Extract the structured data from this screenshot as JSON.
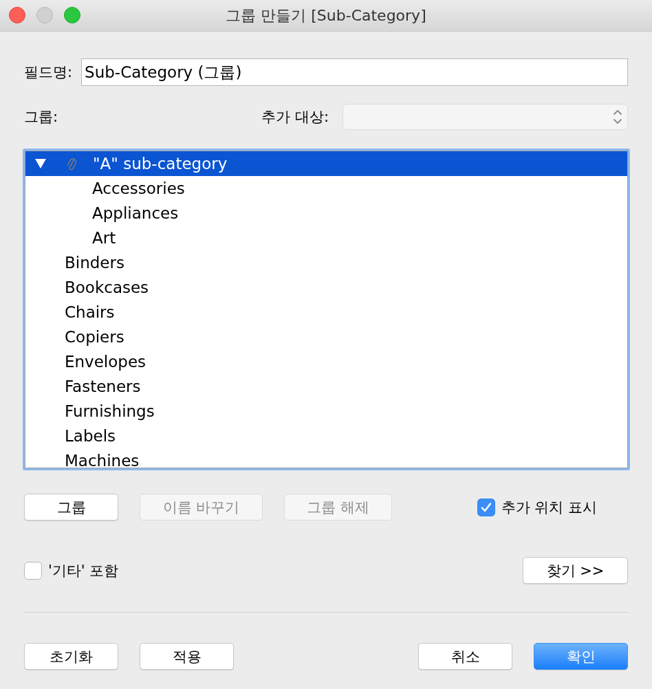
{
  "window": {
    "title": "그룹 만들기 [Sub-Category]"
  },
  "field_name": {
    "label": "필드명:",
    "value": "Sub-Category (그룹)"
  },
  "group_label": "그룹:",
  "add_to": {
    "label": "추가 대상:",
    "disabled": true
  },
  "tree": {
    "items": [
      {
        "kind": "group",
        "label": "\"A\" sub-category",
        "expanded": true,
        "selected": true,
        "children": [
          {
            "kind": "member",
            "label": "Accessories",
            "selected": false
          },
          {
            "kind": "member",
            "label": "Appliances",
            "selected": false
          },
          {
            "kind": "member",
            "label": "Art",
            "selected": false
          }
        ]
      },
      {
        "kind": "member",
        "label": "Binders",
        "selected": false
      },
      {
        "kind": "member",
        "label": "Bookcases",
        "selected": false
      },
      {
        "kind": "member",
        "label": "Chairs",
        "selected": false
      },
      {
        "kind": "member",
        "label": "Copiers",
        "selected": false
      },
      {
        "kind": "member",
        "label": "Envelopes",
        "selected": false
      },
      {
        "kind": "member",
        "label": "Fasteners",
        "selected": false
      },
      {
        "kind": "member",
        "label": "Furnishings",
        "selected": false
      },
      {
        "kind": "member",
        "label": "Labels",
        "selected": false
      },
      {
        "kind": "member",
        "label": "Machines",
        "selected": false
      }
    ]
  },
  "actions": [
    {
      "label": "그룹",
      "disabled": false
    },
    {
      "label": "이름 바꾸기",
      "disabled": true
    },
    {
      "label": "그룹 해제",
      "disabled": true
    }
  ],
  "show_location": {
    "label": "추가 위치 표시",
    "checked": true
  },
  "include_other": {
    "label": "'기타' 포함",
    "checked": false
  },
  "find_button": {
    "label": "찾기 >>"
  },
  "footer": {
    "left": [
      {
        "label": "초기화",
        "default": false
      },
      {
        "label": "적용",
        "default": false
      }
    ],
    "right": [
      {
        "label": "취소",
        "default": false
      },
      {
        "label": "확인",
        "default": true
      }
    ]
  }
}
